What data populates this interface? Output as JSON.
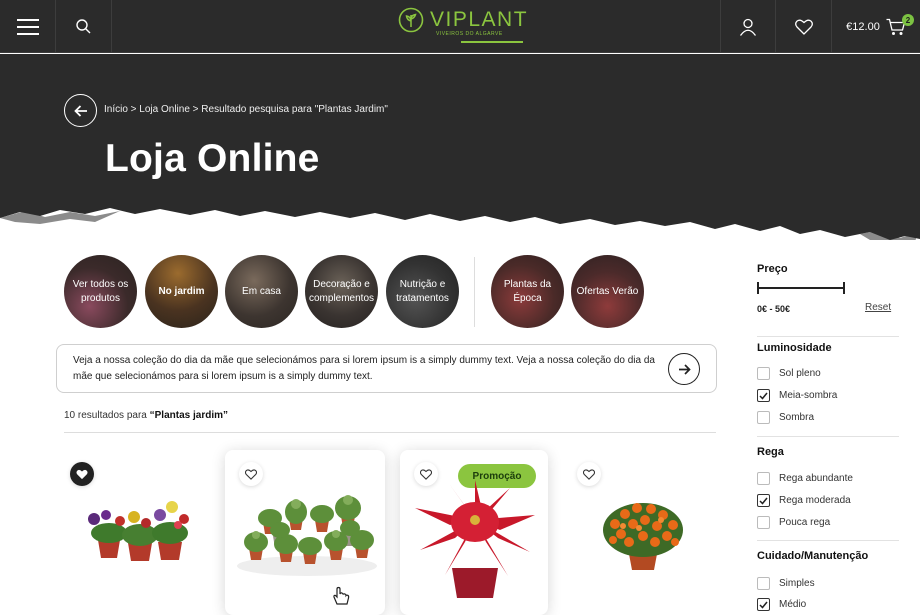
{
  "header": {
    "logo_text": "VIPLANT",
    "logo_subtitle": "VIVEIROS DO ALGARVE",
    "cart_total": "€12.00",
    "cart_count": "2",
    "brand_color": "#8bc53f",
    "icons": [
      "menu-icon",
      "search-icon",
      "user-icon",
      "heart-icon",
      "cart-icon"
    ]
  },
  "hero": {
    "breadcrumb": "Início > Loja Online > Resultado pesquisa para \"Plantas Jardim\"",
    "title": "Loja Online"
  },
  "categories": [
    {
      "label": "Ver todos os produtos",
      "bold": false
    },
    {
      "label": "No jardim",
      "bold": true
    },
    {
      "label": "Em casa",
      "bold": false
    },
    {
      "label": "Decoração e complementos",
      "bold": false
    },
    {
      "label": "Nutrição e tratamentos",
      "bold": false
    },
    {
      "label": "Plantas da Época",
      "bold": false
    },
    {
      "label": "Ofertas Verão",
      "bold": false
    }
  ],
  "info_banner": {
    "text": "Veja a nossa coleção do dia da mãe que selecionámos para si lorem ipsum is a simply dummy text. Veja a nossa coleção do dia da mãe que selecionámos para si lorem ipsum is a simply dummy text."
  },
  "results": {
    "prefix": "10 resultados para",
    "query": "“Plantas jardim”"
  },
  "products": [
    {
      "favorited": true,
      "promo": ""
    },
    {
      "favorited": false,
      "promo": ""
    },
    {
      "favorited": false,
      "promo": "Promoção"
    },
    {
      "favorited": false,
      "promo": ""
    }
  ],
  "filters": {
    "price": {
      "title": "Preço",
      "range": "0€ - 50€",
      "reset": "Reset"
    },
    "luminosidade": {
      "title": "Luminosidade",
      "options": [
        {
          "label": "Sol pleno",
          "checked": false
        },
        {
          "label": "Meia-sombra",
          "checked": true
        },
        {
          "label": "Sombra",
          "checked": false
        }
      ]
    },
    "rega": {
      "title": "Rega",
      "options": [
        {
          "label": "Rega abundante",
          "checked": false
        },
        {
          "label": "Rega moderada",
          "checked": true
        },
        {
          "label": "Pouca rega",
          "checked": false
        }
      ]
    },
    "cuidado": {
      "title": "Cuidado/Manutenção",
      "options": [
        {
          "label": "Simples",
          "checked": false
        },
        {
          "label": "Médio",
          "checked": true
        }
      ]
    }
  }
}
